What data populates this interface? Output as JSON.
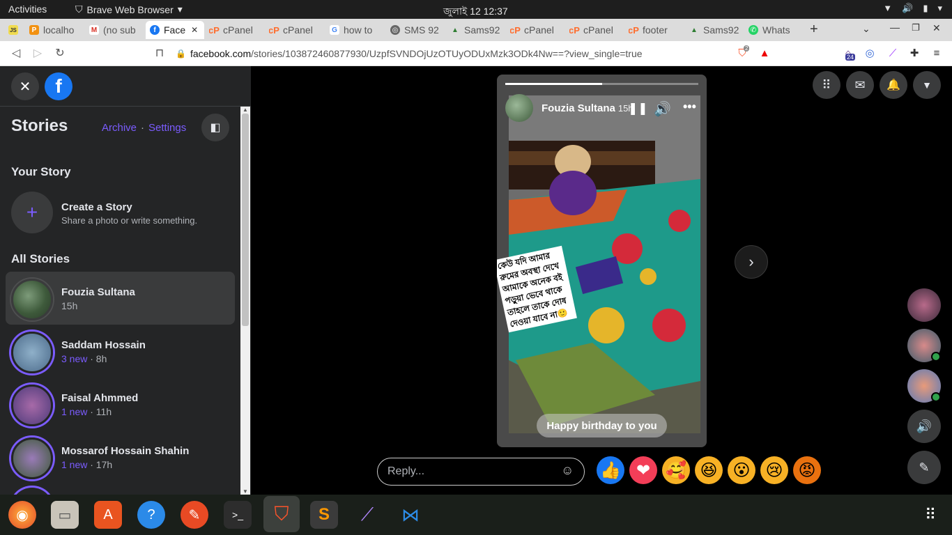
{
  "system": {
    "activities": "Activities",
    "app_name": "Brave Web Browser",
    "clock": "জুলাই 12  12:37"
  },
  "tabs": [
    {
      "label": "localho",
      "icon": "phpmyadmin-icon"
    },
    {
      "label": "(no sub",
      "icon": "gmail-icon"
    },
    {
      "label": "Face",
      "icon": "facebook-icon"
    },
    {
      "label": "cPanel",
      "icon": "cpanel-icon"
    },
    {
      "label": "cPanel",
      "icon": "cpanel-icon"
    },
    {
      "label": "how to",
      "icon": "google-icon"
    },
    {
      "label": "SMS 92",
      "icon": "globe-icon"
    },
    {
      "label": "Sams92",
      "icon": "triangle-icon"
    },
    {
      "label": "cPanel",
      "icon": "cpanel-icon"
    },
    {
      "label": "cPanel",
      "icon": "cpanel-icon"
    },
    {
      "label": "footer",
      "icon": "cpanel-icon"
    },
    {
      "label": "Sams92",
      "icon": "triangle-icon"
    },
    {
      "label": "Whats",
      "icon": "whatsapp-icon"
    }
  ],
  "address": {
    "domain": "facebook.com",
    "path": "/stories/103872460877930/UzpfSVNDOjUzOTUyODUxMzk3ODk4Nw==?view_single=true",
    "shield_count": "2",
    "ext_badge": "24"
  },
  "sidebar": {
    "title": "Stories",
    "archive": "Archive",
    "dot": "·",
    "settings": "Settings",
    "your_story": "Your Story",
    "create_title": "Create a Story",
    "create_sub": "Share a photo or write something.",
    "all_stories": "All Stories",
    "stories": [
      {
        "name": "Fouzia Sultana",
        "new": "",
        "time": "15h"
      },
      {
        "name": "Saddam Hossain",
        "new": "3 new",
        "time": " · 8h"
      },
      {
        "name": "Faisal Ahmmed",
        "new": "1 new",
        "time": " · 11h"
      },
      {
        "name": "Mossarof Hossain Shahin",
        "new": "1 new",
        "time": " · 17h"
      }
    ]
  },
  "viewer": {
    "author": "Fouzia Sultana",
    "time": "15h",
    "progress": 0.5,
    "overlay_text": "কেউ যদি আমার রুমের অবস্থা দেখে আমাকে অনেক বই পড়ুয়া ভেবে থাকে তাহলে তাকে দোষ দেওয়া যাবে না🙂",
    "caption": "Happy birthday to you",
    "reply_placeholder": "Reply...",
    "reactions": [
      "👍",
      "❤",
      "🥰",
      "😆",
      "😮",
      "😢",
      "😡"
    ]
  }
}
